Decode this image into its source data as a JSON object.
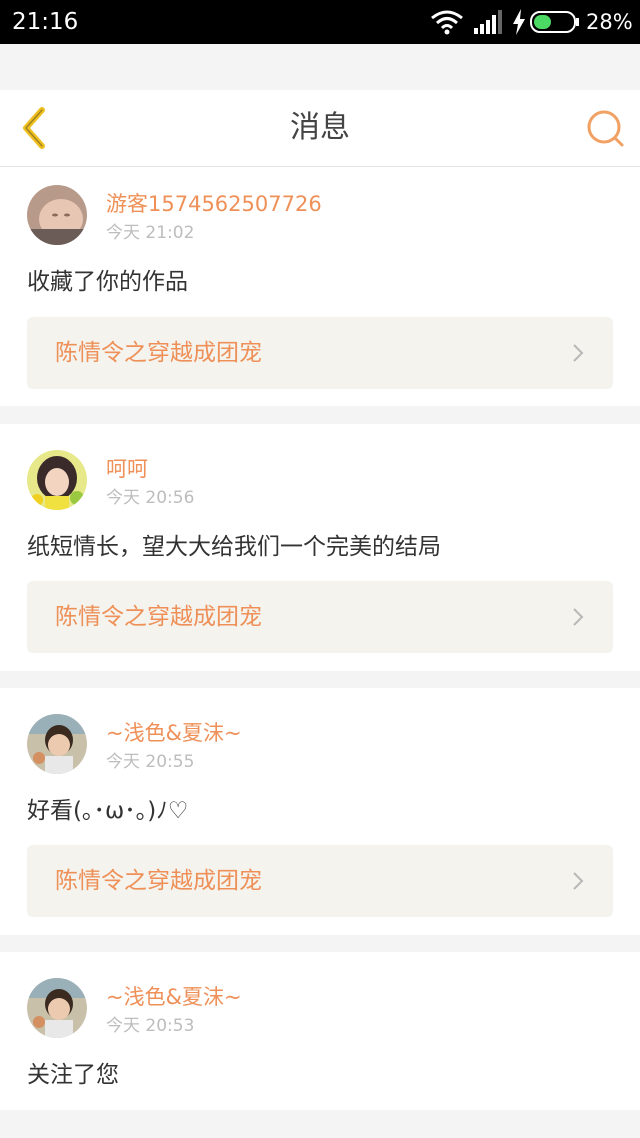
{
  "status_bar": {
    "time": "21:16",
    "battery_percent": "28%",
    "battery_level": 0.28,
    "icons": [
      "wifi-icon",
      "signal-icon",
      "charging-bolt-icon",
      "battery-icon"
    ]
  },
  "header": {
    "title": "消息",
    "back_icon": "chevron-left-icon",
    "search_icon": "search-icon"
  },
  "colors": {
    "accent": "#ee9058",
    "back_icon": "#f0c020",
    "text": "#333333",
    "meta": "#bdbdbd",
    "link_bg": "#f4f3ee",
    "page_bg": "#f4f4f4"
  },
  "messages": [
    {
      "username": "游客1574562507726",
      "time": "今天 21:02",
      "text": "收藏了你的作品",
      "work_title": "陈情令之穿越成团宠"
    },
    {
      "username": "呵呵",
      "time": "今天 20:56",
      "text": "纸短情长，望大大给我们一个完美的结局",
      "work_title": "陈情令之穿越成团宠"
    },
    {
      "username": "~浅色&夏沫~",
      "time": "今天 20:55",
      "text": "好看(｡･ω･｡)ﾉ♡",
      "work_title": "陈情令之穿越成团宠"
    },
    {
      "username": "~浅色&夏沫~",
      "time": "今天 20:53",
      "text": "关注了您"
    }
  ]
}
